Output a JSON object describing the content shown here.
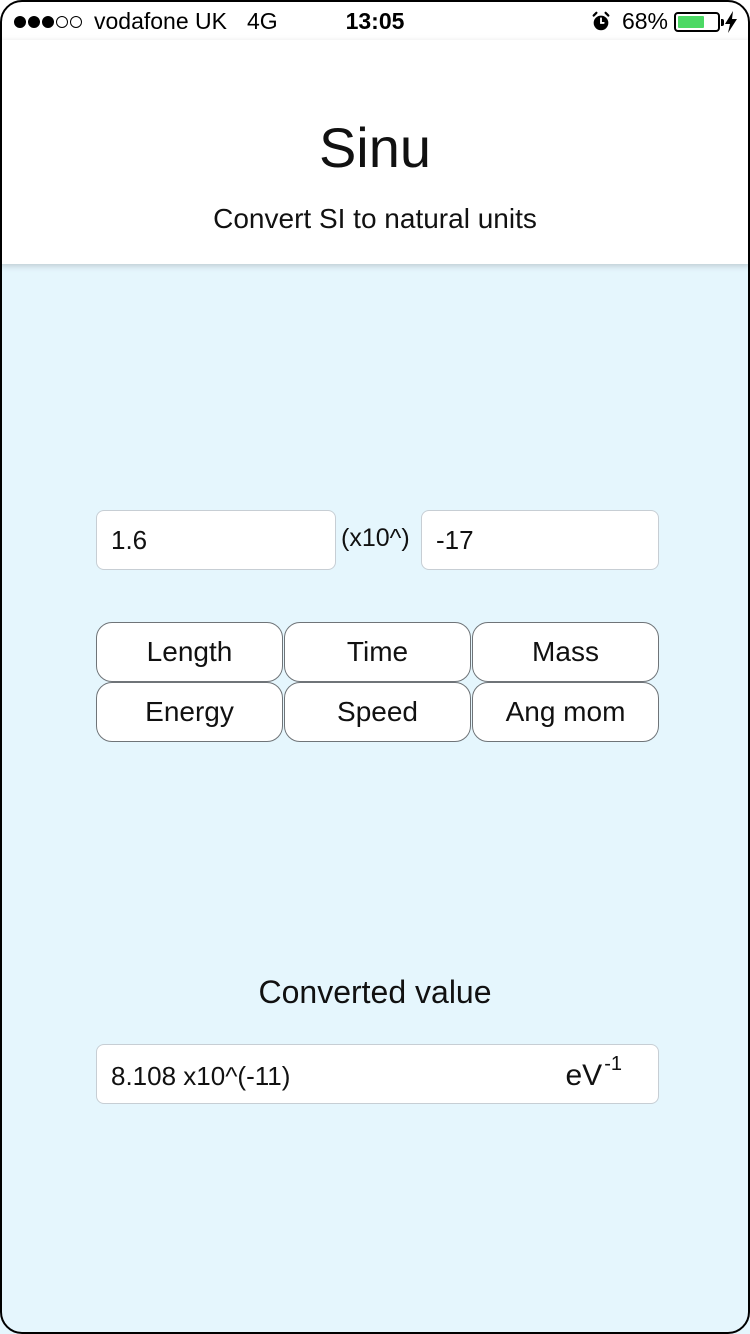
{
  "status_bar": {
    "carrier": "vodafone UK",
    "network": "4G",
    "time": "13:05",
    "battery_percent": "68%",
    "battery_level": 0.68,
    "signal_bars_filled": 3,
    "signal_bars_total": 5
  },
  "header": {
    "title": "Sinu",
    "subtitle": "Convert SI to natural units"
  },
  "input": {
    "mantissa": "1.6",
    "multiplier_label": "(x10^)",
    "exponent": "-17"
  },
  "unit_buttons": [
    "Length",
    "Time",
    "Mass",
    "Energy",
    "Speed",
    "Ang mom"
  ],
  "result": {
    "label": "Converted value",
    "value": "8.108 x10^(-11)",
    "unit_base": "eV",
    "unit_exponent": "-1"
  },
  "colors": {
    "background": "#e5f6fd",
    "header": "#ffffff",
    "battery": "#4cd964"
  }
}
